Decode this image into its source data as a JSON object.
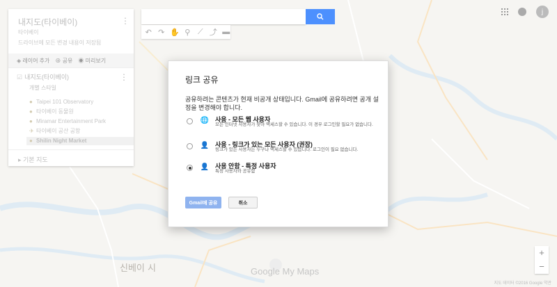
{
  "panel": {
    "title": "내지도(타이베이)",
    "subtitle": "타이베이",
    "description": "드라이브에 모든 변경 내용이 저장됨",
    "actions": [
      {
        "label": "레이어 추가"
      },
      {
        "label": "공유"
      },
      {
        "label": "미리보기"
      }
    ],
    "layer": {
      "name": "내지도(타이베이)",
      "style": "개별 스타일",
      "items": [
        {
          "label": "Taipei 101 Observatory",
          "icon": "pin-icon"
        },
        {
          "label": "타이베이 동물원",
          "icon": "circle-icon"
        },
        {
          "label": "Miramar Entertainment Park",
          "icon": "pin-icon"
        },
        {
          "label": "타이베이 공산 공항",
          "icon": "airport-icon"
        },
        {
          "label": "Shilin Night Market",
          "icon": "circle-icon",
          "selected": true
        }
      ]
    },
    "basemap": "기본 지도"
  },
  "dialog": {
    "title": "링크 공유",
    "message": "공유하려는 콘텐츠가 현재 비공개 상태입니다. Gmail에 공유하려면 공개 설정을 변경해야 합니다.",
    "options": [
      {
        "title": "사용 - 모든 웹 사용자",
        "desc": "모든 인터넷 사용자가 찾아 액세스할 수 있습니다. 이 경우 로그인할 필요가 없습니다.",
        "icon": "globe-icon",
        "selected": false
      },
      {
        "title": "사용 - 링크가 있는 모든 사용자 (권장)",
        "desc": "링크가 있는 사용자는 누구나 액세스할 수 있습니다. 로그인이 필요 없습니다.",
        "icon": "link-user-icon",
        "selected": false
      },
      {
        "title": "사용 안함 - 특정 사용자",
        "desc": "특정 사용자와 공유함",
        "icon": "person-icon",
        "selected": true
      }
    ],
    "primary_button": "Gmail에 공유",
    "cancel_button": "취소"
  },
  "map": {
    "labels": [
      "신베이 시",
      "Google My Maps"
    ],
    "footer": "지도 데이터 ©2016 Google   약관"
  },
  "user": {
    "avatar_letter": "j"
  },
  "colors": {
    "accent": "#4d90fe",
    "primary_disabled": "#8fb3ef"
  }
}
